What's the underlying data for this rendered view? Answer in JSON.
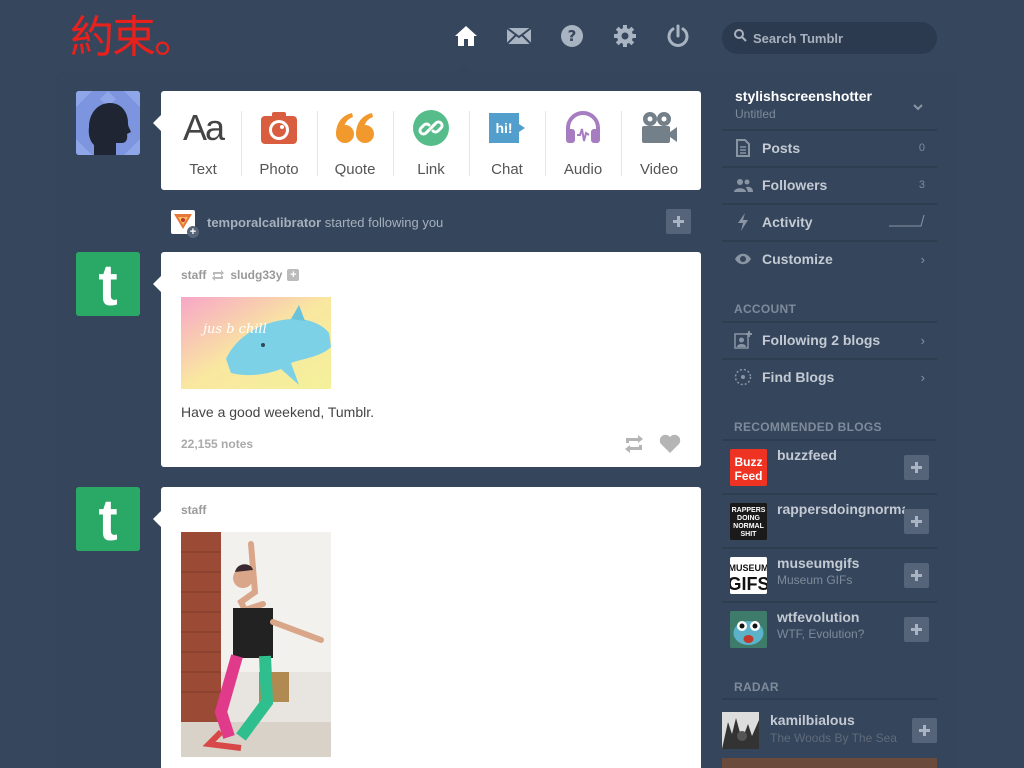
{
  "header": {
    "logo_text": "約束。",
    "search_placeholder": "Search Tumblr",
    "nav_icons": [
      "home-icon",
      "mail-icon",
      "help-icon",
      "settings-icon",
      "power-icon"
    ]
  },
  "colors": {
    "background": "#36465d",
    "panel": "#35455b",
    "tumblr_green": "#2aa966",
    "text_orange": "#ef7a36",
    "photo_red": "#d95e40",
    "quote_orange": "#f2992e",
    "link_green": "#56bc8a",
    "chat_blue": "#529ecc",
    "audio_purple": "#a77dc2",
    "video_gray": "#748089"
  },
  "post_types": [
    {
      "label": "Text",
      "icon": "text-icon"
    },
    {
      "label": "Photo",
      "icon": "camera-icon"
    },
    {
      "label": "Quote",
      "icon": "quote-icon"
    },
    {
      "label": "Link",
      "icon": "link-icon"
    },
    {
      "label": "Chat",
      "icon": "chat-icon"
    },
    {
      "label": "Audio",
      "icon": "headphones-icon"
    },
    {
      "label": "Video",
      "icon": "video-camera-icon"
    }
  ],
  "follow_notification": {
    "username": "temporalcalibrator",
    "text": "started following you"
  },
  "posts": [
    {
      "author": "staff",
      "reblogged_from": "sludg33y",
      "image_caption": "jus b chill",
      "body": "Have a good weekend, Tumblr.",
      "notes": "22,155 notes"
    },
    {
      "author": "staff"
    }
  ],
  "sidebar": {
    "blog_name": "stylishscreenshotter",
    "blog_title": "Untitled",
    "stats": [
      {
        "label": "Posts",
        "count": "0"
      },
      {
        "label": "Followers",
        "count": "3"
      },
      {
        "label": "Activity",
        "count": ""
      },
      {
        "label": "Customize",
        "count": ""
      }
    ],
    "account_title": "ACCOUNT",
    "account_items": [
      {
        "label": "Following 2 blogs"
      },
      {
        "label": "Find Blogs"
      }
    ],
    "recommended_title": "RECOMMENDED BLOGS",
    "recommended": [
      {
        "name": "buzzfeed",
        "sub": "",
        "avatar_text": "Buzz Feed"
      },
      {
        "name": "rappersdoingnormalstuff",
        "sub": "",
        "avatar_text": "RAPPERS DOING NORMAL SHIT"
      },
      {
        "name": "museumgifs",
        "sub": "Museum GIFs",
        "avatar_text": "MUSEUM GIFS"
      },
      {
        "name": "wtfevolution",
        "sub": "WTF, Evolution?",
        "avatar_text": ""
      }
    ],
    "radar_title": "RADAR",
    "radar": {
      "name": "kamilbialous",
      "sub": "The Woods By The Sea"
    }
  }
}
